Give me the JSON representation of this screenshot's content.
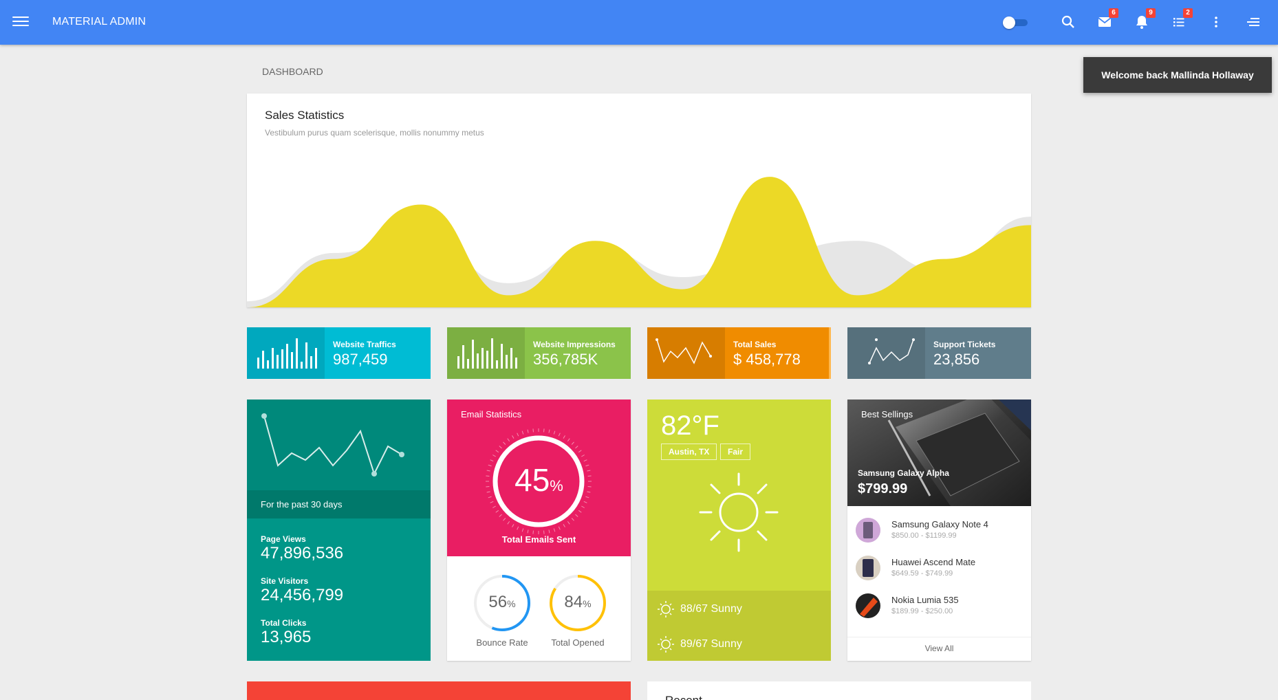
{
  "header": {
    "title": "MATERIAL ADMIN",
    "badges": {
      "mail": "6",
      "notifications": "9",
      "tasks": "2"
    },
    "accent": "#4285f4"
  },
  "toast": {
    "text": "Welcome back Mallinda Hollaway"
  },
  "breadcrumb": {
    "label": "DASHBOARD"
  },
  "sales": {
    "title": "Sales Statistics",
    "subtitle": "Vestibulum purus quam scelerisque, mollis nonummy metus",
    "chart_data": {
      "type": "area",
      "title": "Sales Statistics",
      "x": [
        0,
        1,
        2,
        3,
        4,
        5,
        6,
        7,
        8,
        9
      ],
      "series": [
        {
          "color": "#e6e6e6",
          "values": [
            5,
            45,
            60,
            20,
            50,
            25,
            45,
            55,
            30,
            75
          ]
        },
        {
          "color": "#ecd926",
          "values": [
            0,
            40,
            85,
            10,
            55,
            15,
            108,
            10,
            40,
            68
          ]
        }
      ],
      "ylim": [
        0,
        120
      ],
      "grid": false
    }
  },
  "stats": [
    {
      "label": "Website Traffics",
      "value": "987,459",
      "color": "#00bcd4"
    },
    {
      "label": "Website Impressions",
      "value": "356,785K",
      "color": "#8bc34a"
    },
    {
      "label": "Total Sales",
      "value": "$ 458,778",
      "color": "#f08c00"
    },
    {
      "label": "Support Tickets",
      "value": "23,856",
      "color": "#607d8b"
    }
  ],
  "traffic": {
    "caption": "For the past 30 days",
    "items": [
      {
        "label": "Page Views",
        "value": "47,896,536"
      },
      {
        "label": "Site Visitors",
        "value": "24,456,799"
      },
      {
        "label": "Total Clicks",
        "value": "13,965"
      }
    ]
  },
  "email": {
    "title": "Email Statistics",
    "percent": "45",
    "percent_sign": "%",
    "caption": "Total Emails Sent",
    "bounce": {
      "value": "56",
      "label": "Bounce Rate",
      "fraction": 0.56
    },
    "opened": {
      "value": "84",
      "label": "Total Opened",
      "fraction": 0.84
    },
    "sent_fraction": 0.45
  },
  "weather": {
    "temp": "82°F",
    "location": "Austin, TX",
    "condition": "Fair",
    "forecast": [
      {
        "text": "88/67  Sunny"
      },
      {
        "text": "89/67  Sunny"
      }
    ]
  },
  "best": {
    "title": "Best Sellings",
    "featured_name": "Samsung Galaxy Alpha",
    "featured_price": "$799.99",
    "products": [
      {
        "name": "Samsung Galaxy Note 4",
        "price": "$850.00 - $1199.99"
      },
      {
        "name": "Huawei Ascend Mate",
        "price": "$649.59 - $749.99"
      },
      {
        "name": "Nokia Lumia 535",
        "price": "$189.99 - $250.00"
      }
    ],
    "view_all": "View All"
  },
  "bottom": {
    "title": "Recent"
  }
}
